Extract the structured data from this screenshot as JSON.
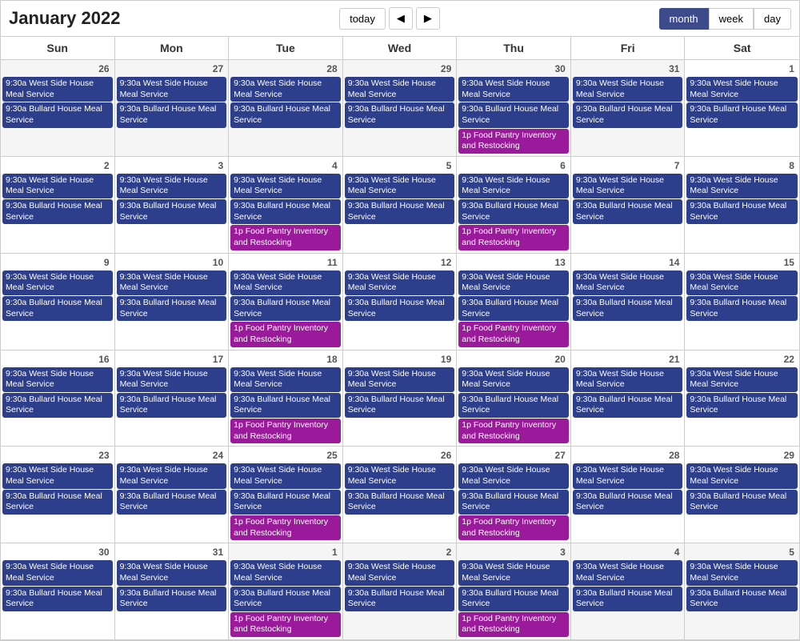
{
  "header": {
    "title": "January 2022",
    "today_label": "today",
    "prev_label": "◀",
    "next_label": "▶",
    "views": [
      "month",
      "week",
      "day"
    ],
    "active_view": "month"
  },
  "day_headers": [
    "Sun",
    "Mon",
    "Tue",
    "Wed",
    "Thu",
    "Fri",
    "Sat"
  ],
  "events": {
    "west_side": "9:30a West Side House Meal Service",
    "bullard": "9:30a Bullard House Meal Service",
    "food_pantry": "1p Food Pantry Inventory and Restocking"
  },
  "weeks": [
    {
      "days": [
        {
          "num": "26",
          "other": true,
          "has_west": true,
          "has_bullard": true,
          "has_pantry": false
        },
        {
          "num": "27",
          "other": true,
          "has_west": true,
          "has_bullard": true,
          "has_pantry": false
        },
        {
          "num": "28",
          "other": true,
          "has_west": true,
          "has_bullard": true,
          "has_pantry": false
        },
        {
          "num": "29",
          "other": true,
          "has_west": true,
          "has_bullard": true,
          "has_pantry": false
        },
        {
          "num": "30",
          "other": true,
          "has_west": true,
          "has_bullard": true,
          "has_pantry": true
        },
        {
          "num": "31",
          "other": true,
          "has_west": true,
          "has_bullard": true,
          "has_pantry": false
        },
        {
          "num": "1",
          "other": false,
          "has_west": true,
          "has_bullard": true,
          "has_pantry": false
        }
      ]
    },
    {
      "days": [
        {
          "num": "2",
          "other": false,
          "has_west": true,
          "has_bullard": true,
          "has_pantry": false
        },
        {
          "num": "3",
          "other": false,
          "has_west": true,
          "has_bullard": true,
          "has_pantry": false
        },
        {
          "num": "4",
          "other": false,
          "has_west": true,
          "has_bullard": true,
          "has_pantry": true
        },
        {
          "num": "5",
          "other": false,
          "has_west": true,
          "has_bullard": true,
          "has_pantry": false
        },
        {
          "num": "6",
          "other": false,
          "has_west": true,
          "has_bullard": true,
          "has_pantry": true
        },
        {
          "num": "7",
          "other": false,
          "has_west": true,
          "has_bullard": true,
          "has_pantry": false
        },
        {
          "num": "8",
          "other": false,
          "has_west": true,
          "has_bullard": true,
          "has_pantry": false
        }
      ]
    },
    {
      "days": [
        {
          "num": "9",
          "other": false,
          "has_west": true,
          "has_bullard": true,
          "has_pantry": false
        },
        {
          "num": "10",
          "other": false,
          "has_west": true,
          "has_bullard": true,
          "has_pantry": false
        },
        {
          "num": "11",
          "other": false,
          "has_west": true,
          "has_bullard": true,
          "has_pantry": true
        },
        {
          "num": "12",
          "other": false,
          "has_west": true,
          "has_bullard": true,
          "has_pantry": false
        },
        {
          "num": "13",
          "other": false,
          "has_west": true,
          "has_bullard": true,
          "has_pantry": true
        },
        {
          "num": "14",
          "other": false,
          "has_west": true,
          "has_bullard": true,
          "has_pantry": false
        },
        {
          "num": "15",
          "other": false,
          "has_west": true,
          "has_bullard": true,
          "has_pantry": false
        }
      ]
    },
    {
      "days": [
        {
          "num": "16",
          "other": false,
          "has_west": true,
          "has_bullard": true,
          "has_pantry": false
        },
        {
          "num": "17",
          "other": false,
          "has_west": true,
          "has_bullard": true,
          "has_pantry": false
        },
        {
          "num": "18",
          "other": false,
          "has_west": true,
          "has_bullard": true,
          "has_pantry": true
        },
        {
          "num": "19",
          "other": false,
          "has_west": true,
          "has_bullard": true,
          "has_pantry": false
        },
        {
          "num": "20",
          "other": false,
          "has_west": true,
          "has_bullard": true,
          "has_pantry": true
        },
        {
          "num": "21",
          "other": false,
          "has_west": true,
          "has_bullard": true,
          "has_pantry": false
        },
        {
          "num": "22",
          "other": false,
          "has_west": true,
          "has_bullard": true,
          "has_pantry": false
        }
      ]
    },
    {
      "days": [
        {
          "num": "23",
          "other": false,
          "has_west": true,
          "has_bullard": true,
          "has_pantry": false
        },
        {
          "num": "24",
          "other": false,
          "has_west": true,
          "has_bullard": true,
          "has_pantry": false
        },
        {
          "num": "25",
          "other": false,
          "has_west": true,
          "has_bullard": true,
          "has_pantry": true
        },
        {
          "num": "26",
          "other": false,
          "has_west": true,
          "has_bullard": true,
          "has_pantry": false
        },
        {
          "num": "27",
          "other": false,
          "has_west": true,
          "has_bullard": true,
          "has_pantry": true
        },
        {
          "num": "28",
          "other": false,
          "has_west": true,
          "has_bullard": true,
          "has_pantry": false
        },
        {
          "num": "29",
          "other": false,
          "has_west": true,
          "has_bullard": true,
          "has_pantry": false
        }
      ]
    },
    {
      "days": [
        {
          "num": "30",
          "other": false,
          "has_west": true,
          "has_bullard": true,
          "has_pantry": false
        },
        {
          "num": "31",
          "other": false,
          "has_west": true,
          "has_bullard": true,
          "has_pantry": false
        },
        {
          "num": "1",
          "other": true,
          "has_west": true,
          "has_bullard": true,
          "has_pantry": true
        },
        {
          "num": "2",
          "other": true,
          "has_west": true,
          "has_bullard": true,
          "has_pantry": false
        },
        {
          "num": "3",
          "other": true,
          "has_west": true,
          "has_bullard": true,
          "has_pantry": true
        },
        {
          "num": "4",
          "other": true,
          "has_west": true,
          "has_bullard": true,
          "has_pantry": false
        },
        {
          "num": "5",
          "other": true,
          "has_west": true,
          "has_bullard": true,
          "has_pantry": false
        }
      ]
    }
  ]
}
